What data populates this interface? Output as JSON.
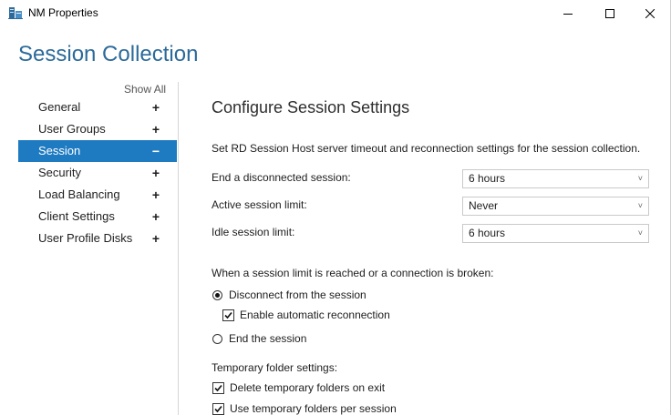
{
  "window": {
    "title": "NM Properties"
  },
  "header": {
    "title": "Session Collection"
  },
  "sidebar": {
    "show_all": "Show All",
    "items": [
      {
        "label": "General",
        "sign": "+"
      },
      {
        "label": "User Groups",
        "sign": "+"
      },
      {
        "label": "Session",
        "sign": "−",
        "active": true
      },
      {
        "label": "Security",
        "sign": "+"
      },
      {
        "label": "Load Balancing",
        "sign": "+"
      },
      {
        "label": "Client Settings",
        "sign": "+"
      },
      {
        "label": "User Profile Disks",
        "sign": "+"
      }
    ]
  },
  "main": {
    "heading": "Configure Session Settings",
    "description": "Set RD Session Host server timeout and reconnection settings for the session collection.",
    "fields": [
      {
        "label": "End a disconnected session:",
        "value": "6 hours"
      },
      {
        "label": "Active session limit:",
        "value": "Never"
      },
      {
        "label": "Idle session limit:",
        "value": "6 hours"
      }
    ],
    "limit_section": {
      "label": "When a session limit is reached or a connection is broken:",
      "disconnect": "Disconnect from the session",
      "auto_reconnect": "Enable automatic reconnection",
      "end": "End the session"
    },
    "temp_section": {
      "label": "Temporary folder settings:",
      "delete_on_exit": "Delete temporary folders on exit",
      "per_session": "Use temporary folders per session"
    }
  },
  "colors": {
    "accent": "#1f7bc1",
    "title": "#2b6a9a"
  },
  "icons": {
    "app": "server-properties-icon",
    "minimize": "minimize-icon",
    "maximize": "maximize-icon",
    "close": "close-icon",
    "dropdown": "chevron-down-icon"
  }
}
